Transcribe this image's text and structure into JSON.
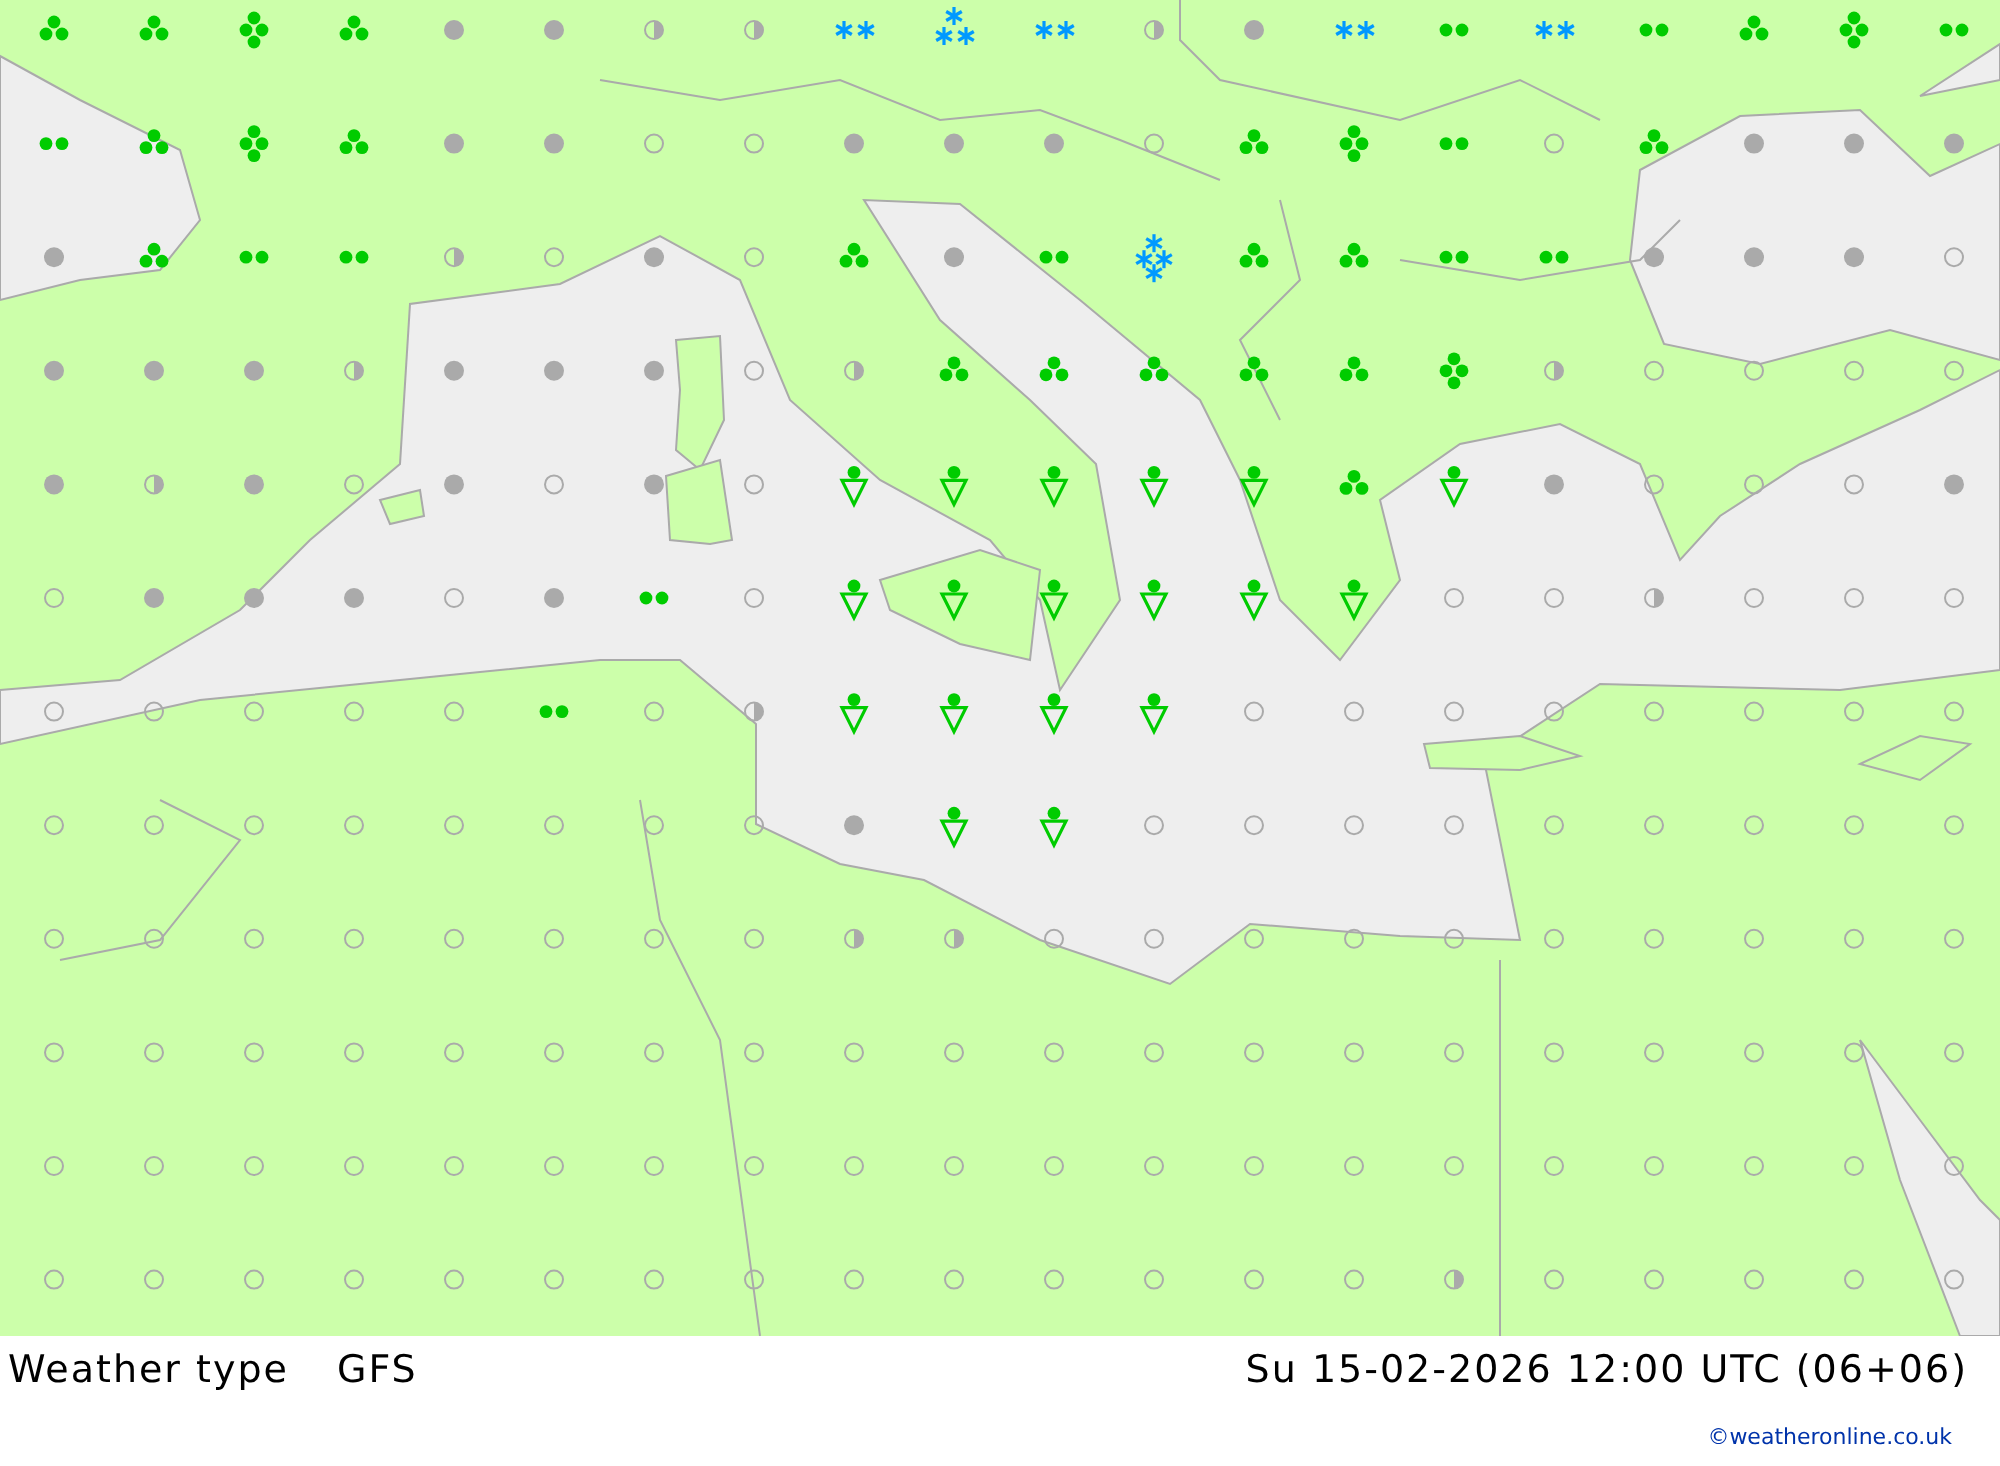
{
  "map": {
    "rows": [
      [
        {
          "kind": "rain"
        },
        {
          "kind": "rain"
        },
        {
          "kind": "heavy_rain"
        },
        {
          "kind": "rain"
        },
        {
          "kind": "overcast"
        },
        {
          "kind": "overcast"
        },
        {
          "kind": "partly_cloudy"
        },
        {
          "kind": "partly_cloudy"
        },
        {
          "kind": "snow"
        },
        {
          "kind": "heavy_snow"
        },
        {
          "kind": "snow"
        },
        {
          "kind": "partly_cloudy"
        },
        {
          "kind": "overcast"
        },
        {
          "kind": "snow"
        },
        {
          "kind": "drizzle"
        },
        {
          "kind": "snow"
        },
        {
          "kind": "drizzle"
        },
        {
          "kind": "rain"
        },
        {
          "kind": "heavy_rain"
        },
        {
          "kind": "drizzle"
        }
      ],
      [
        {
          "kind": "drizzle"
        },
        {
          "kind": "rain"
        },
        {
          "kind": "heavy_rain"
        },
        {
          "kind": "rain"
        },
        {
          "kind": "overcast"
        },
        {
          "kind": "overcast"
        },
        {
          "kind": "clear"
        },
        {
          "kind": "clear"
        },
        {
          "kind": "overcast"
        },
        {
          "kind": "overcast"
        },
        {
          "kind": "overcast"
        },
        {
          "kind": "clear"
        },
        {
          "kind": "rain"
        },
        {
          "kind": "heavy_rain"
        },
        {
          "kind": "drizzle"
        },
        {
          "kind": "clear"
        },
        {
          "kind": "rain"
        },
        {
          "kind": "overcast"
        },
        {
          "kind": "overcast"
        },
        {
          "kind": "overcast"
        }
      ],
      [
        {
          "kind": "overcast"
        },
        {
          "kind": "rain"
        },
        {
          "kind": "drizzle"
        },
        {
          "kind": "drizzle"
        },
        {
          "kind": "partly_cloudy"
        },
        {
          "kind": "clear"
        },
        {
          "kind": "overcast"
        },
        {
          "kind": "clear"
        },
        {
          "kind": "rain"
        },
        {
          "kind": "overcast"
        },
        {
          "kind": "drizzle"
        },
        {
          "kind": "snowstorm"
        },
        {
          "kind": "rain"
        },
        {
          "kind": "rain"
        },
        {
          "kind": "drizzle"
        },
        {
          "kind": "drizzle"
        },
        {
          "kind": "overcast"
        },
        {
          "kind": "overcast"
        },
        {
          "kind": "overcast"
        },
        {
          "kind": "clear"
        }
      ],
      [
        {
          "kind": "overcast"
        },
        {
          "kind": "overcast"
        },
        {
          "kind": "overcast"
        },
        {
          "kind": "partly_cloudy"
        },
        {
          "kind": "overcast"
        },
        {
          "kind": "overcast"
        },
        {
          "kind": "overcast"
        },
        {
          "kind": "clear"
        },
        {
          "kind": "partly_cloudy"
        },
        {
          "kind": "rain"
        },
        {
          "kind": "rain"
        },
        {
          "kind": "rain"
        },
        {
          "kind": "rain"
        },
        {
          "kind": "rain"
        },
        {
          "kind": "heavy_rain"
        },
        {
          "kind": "partly_cloudy"
        },
        {
          "kind": "clear"
        },
        {
          "kind": "clear"
        },
        {
          "kind": "clear"
        },
        {
          "kind": "clear"
        }
      ],
      [
        {
          "kind": "overcast"
        },
        {
          "kind": "partly_cloudy"
        },
        {
          "kind": "overcast"
        },
        {
          "kind": "clear"
        },
        {
          "kind": "overcast"
        },
        {
          "kind": "clear"
        },
        {
          "kind": "overcast"
        },
        {
          "kind": "clear"
        },
        {
          "kind": "showers"
        },
        {
          "kind": "showers"
        },
        {
          "kind": "showers"
        },
        {
          "kind": "showers"
        },
        {
          "kind": "showers"
        },
        {
          "kind": "rain"
        },
        {
          "kind": "showers"
        },
        {
          "kind": "overcast"
        },
        {
          "kind": "clear"
        },
        {
          "kind": "clear"
        },
        {
          "kind": "clear"
        },
        {
          "kind": "overcast"
        }
      ],
      [
        {
          "kind": "clear"
        },
        {
          "kind": "overcast"
        },
        {
          "kind": "overcast"
        },
        {
          "kind": "overcast"
        },
        {
          "kind": "clear"
        },
        {
          "kind": "overcast"
        },
        {
          "kind": "drizzle"
        },
        {
          "kind": "clear"
        },
        {
          "kind": "showers"
        },
        {
          "kind": "showers"
        },
        {
          "kind": "showers"
        },
        {
          "kind": "showers"
        },
        {
          "kind": "showers"
        },
        {
          "kind": "showers"
        },
        {
          "kind": "clear"
        },
        {
          "kind": "clear"
        },
        {
          "kind": "partly_cloudy"
        },
        {
          "kind": "clear"
        },
        {
          "kind": "clear"
        },
        {
          "kind": "clear"
        }
      ],
      [
        {
          "kind": "clear"
        },
        {
          "kind": "clear"
        },
        {
          "kind": "clear"
        },
        {
          "kind": "clear"
        },
        {
          "kind": "clear"
        },
        {
          "kind": "drizzle"
        },
        {
          "kind": "clear"
        },
        {
          "kind": "partly_cloudy"
        },
        {
          "kind": "showers"
        },
        {
          "kind": "showers"
        },
        {
          "kind": "showers"
        },
        {
          "kind": "showers"
        },
        {
          "kind": "clear"
        },
        {
          "kind": "clear"
        },
        {
          "kind": "clear"
        },
        {
          "kind": "clear"
        },
        {
          "kind": "clear"
        },
        {
          "kind": "clear"
        },
        {
          "kind": "clear"
        },
        {
          "kind": "clear"
        }
      ],
      [
        {
          "kind": "clear"
        },
        {
          "kind": "clear"
        },
        {
          "kind": "clear"
        },
        {
          "kind": "clear"
        },
        {
          "kind": "clear"
        },
        {
          "kind": "clear"
        },
        {
          "kind": "clear"
        },
        {
          "kind": "clear"
        },
        {
          "kind": "overcast"
        },
        {
          "kind": "showers"
        },
        {
          "kind": "showers"
        },
        {
          "kind": "clear"
        },
        {
          "kind": "clear"
        },
        {
          "kind": "clear"
        },
        {
          "kind": "clear"
        },
        {
          "kind": "clear"
        },
        {
          "kind": "clear"
        },
        {
          "kind": "clear"
        },
        {
          "kind": "clear"
        },
        {
          "kind": "clear"
        }
      ],
      [
        {
          "kind": "clear"
        },
        {
          "kind": "clear"
        },
        {
          "kind": "clear"
        },
        {
          "kind": "clear"
        },
        {
          "kind": "clear"
        },
        {
          "kind": "clear"
        },
        {
          "kind": "clear"
        },
        {
          "kind": "clear"
        },
        {
          "kind": "partly_cloudy"
        },
        {
          "kind": "partly_cloudy"
        },
        {
          "kind": "clear"
        },
        {
          "kind": "clear"
        },
        {
          "kind": "clear"
        },
        {
          "kind": "clear"
        },
        {
          "kind": "clear"
        },
        {
          "kind": "clear"
        },
        {
          "kind": "clear"
        },
        {
          "kind": "clear"
        },
        {
          "kind": "clear"
        },
        {
          "kind": "clear"
        }
      ],
      [
        {
          "kind": "clear"
        },
        {
          "kind": "clear"
        },
        {
          "kind": "clear"
        },
        {
          "kind": "clear"
        },
        {
          "kind": "clear"
        },
        {
          "kind": "clear"
        },
        {
          "kind": "clear"
        },
        {
          "kind": "clear"
        },
        {
          "kind": "clear"
        },
        {
          "kind": "clear"
        },
        {
          "kind": "clear"
        },
        {
          "kind": "clear"
        },
        {
          "kind": "clear"
        },
        {
          "kind": "clear"
        },
        {
          "kind": "clear"
        },
        {
          "kind": "clear"
        },
        {
          "kind": "clear"
        },
        {
          "kind": "clear"
        },
        {
          "kind": "clear"
        },
        {
          "kind": "clear"
        }
      ],
      [
        {
          "kind": "clear"
        },
        {
          "kind": "clear"
        },
        {
          "kind": "clear"
        },
        {
          "kind": "clear"
        },
        {
          "kind": "clear"
        },
        {
          "kind": "clear"
        },
        {
          "kind": "clear"
        },
        {
          "kind": "clear"
        },
        {
          "kind": "clear"
        },
        {
          "kind": "clear"
        },
        {
          "kind": "clear"
        },
        {
          "kind": "clear"
        },
        {
          "kind": "clear"
        },
        {
          "kind": "clear"
        },
        {
          "kind": "clear"
        },
        {
          "kind": "clear"
        },
        {
          "kind": "clear"
        },
        {
          "kind": "clear"
        },
        {
          "kind": "clear"
        },
        {
          "kind": "clear"
        }
      ],
      [
        {
          "kind": "clear"
        },
        {
          "kind": "clear"
        },
        {
          "kind": "clear"
        },
        {
          "kind": "clear"
        },
        {
          "kind": "clear"
        },
        {
          "kind": "clear"
        },
        {
          "kind": "clear"
        },
        {
          "kind": "clear"
        },
        {
          "kind": "clear"
        },
        {
          "kind": "clear"
        },
        {
          "kind": "clear"
        },
        {
          "kind": "clear"
        },
        {
          "kind": "clear"
        },
        {
          "kind": "clear"
        },
        {
          "kind": "partly_cloudy"
        },
        {
          "kind": "clear"
        },
        {
          "kind": "clear"
        },
        {
          "kind": "clear"
        },
        {
          "kind": "clear"
        },
        {
          "kind": "clear"
        }
      ]
    ]
  },
  "footer": {
    "title": "Weather type",
    "model": "GFS",
    "datetime": "Su 15-02-2026 12:00 UTC (06+06)",
    "credit": "©weatheronline.co.uk"
  }
}
